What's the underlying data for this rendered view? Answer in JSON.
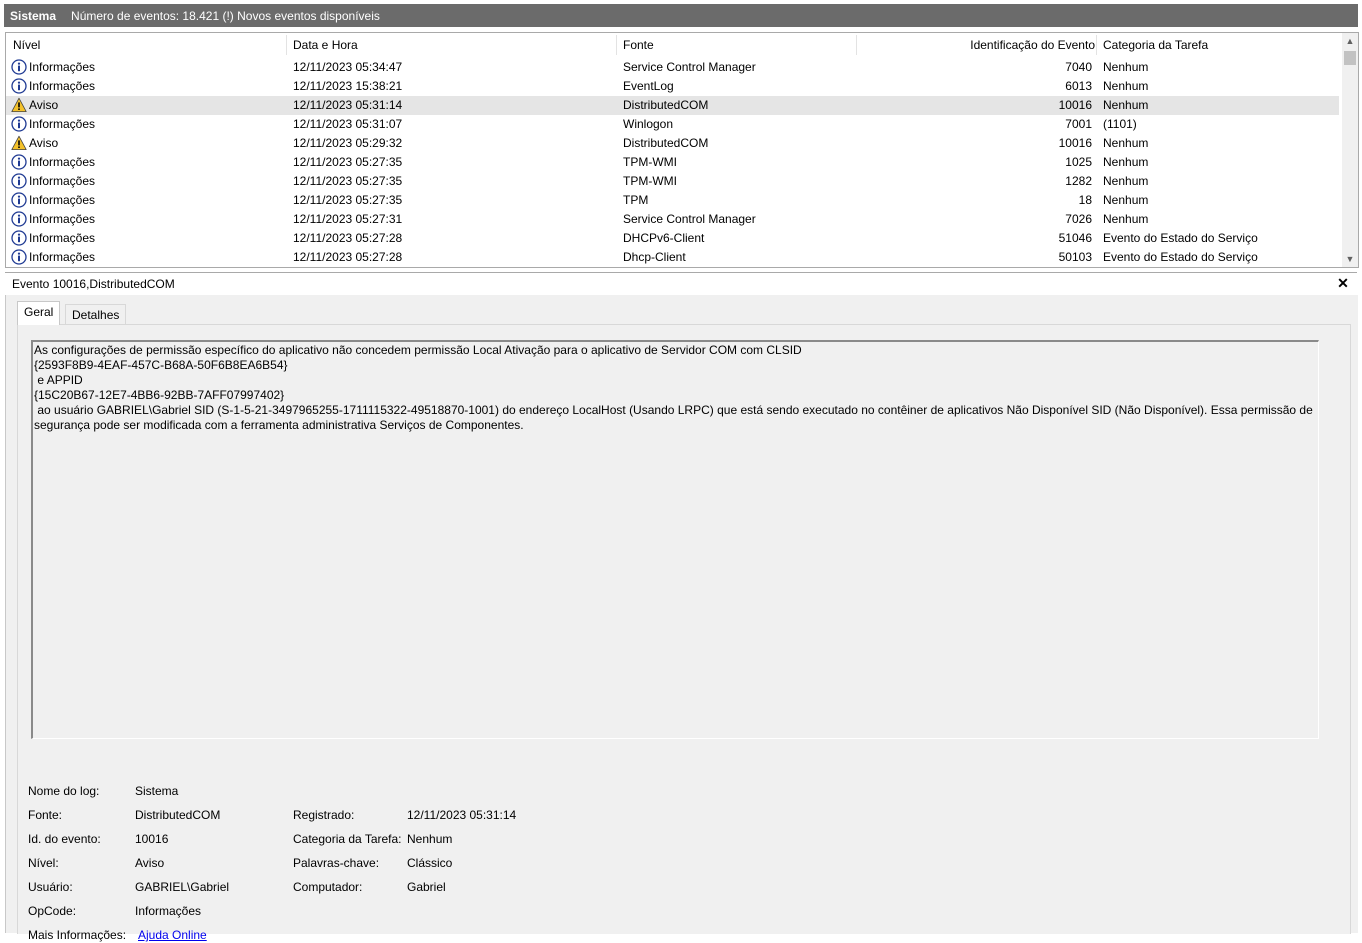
{
  "header": {
    "log_name": "Sistema",
    "info": "Número de eventos: 18.421 (!) Novos eventos disponíveis"
  },
  "columns": {
    "level": "Nível",
    "date": "Data e Hora",
    "source": "Fonte",
    "id": "Identificação do Evento",
    "category": "Categoria da Tarefa"
  },
  "events": [
    {
      "level": "Informações",
      "icon": "info-icon",
      "date": "12/11/2023 05:34:47",
      "source": "Service Control Manager",
      "id": "7040",
      "category": "Nenhum"
    },
    {
      "level": "Informações",
      "icon": "info-icon",
      "date": "12/11/2023 15:38:21",
      "source": "EventLog",
      "id": "6013",
      "category": "Nenhum"
    },
    {
      "level": "Aviso",
      "icon": "warning-icon",
      "date": "12/11/2023 05:31:14",
      "source": "DistributedCOM",
      "id": "10016",
      "category": "Nenhum",
      "selected": true
    },
    {
      "level": "Informações",
      "icon": "info-icon",
      "date": "12/11/2023 05:31:07",
      "source": "Winlogon",
      "id": "7001",
      "category": "(1101)"
    },
    {
      "level": "Aviso",
      "icon": "warning-icon",
      "date": "12/11/2023 05:29:32",
      "source": "DistributedCOM",
      "id": "10016",
      "category": "Nenhum"
    },
    {
      "level": "Informações",
      "icon": "info-icon",
      "date": "12/11/2023 05:27:35",
      "source": "TPM-WMI",
      "id": "1025",
      "category": "Nenhum"
    },
    {
      "level": "Informações",
      "icon": "info-icon",
      "date": "12/11/2023 05:27:35",
      "source": "TPM-WMI",
      "id": "1282",
      "category": "Nenhum"
    },
    {
      "level": "Informações",
      "icon": "info-icon",
      "date": "12/11/2023 05:27:35",
      "source": "TPM",
      "id": "18",
      "category": "Nenhum"
    },
    {
      "level": "Informações",
      "icon": "info-icon",
      "date": "12/11/2023 05:27:31",
      "source": "Service Control Manager",
      "id": "7026",
      "category": "Nenhum"
    },
    {
      "level": "Informações",
      "icon": "info-icon",
      "date": "12/11/2023 05:27:28",
      "source": "DHCPv6-Client",
      "id": "51046",
      "category": "Evento do Estado do Serviço"
    },
    {
      "level": "Informações",
      "icon": "info-icon",
      "date": "12/11/2023 05:27:28",
      "source": "Dhcp-Client",
      "id": "50103",
      "category": "Evento do Estado do Serviço"
    }
  ],
  "detail": {
    "title": "Evento 10016,DistributedCOM",
    "tabs": [
      "Geral",
      "Detalhes"
    ],
    "message_lines": [
      "As configurações de permissão específico do aplicativo não concedem permissão Local Ativação para o aplicativo de Servidor COM com CLSID",
      "{2593F8B9-4EAF-457C-B68A-50F6B8EA6B54}",
      " e APPID",
      "{15C20B67-12E7-4BB6-92BB-7AFF07997402}",
      " ao usuário GABRIEL\\Gabriel SID (S-1-5-21-3497965255-1711115322-49518870-1001) do endereço LocalHost (Usando LRPC) que está sendo executado no contêiner de aplicativos Não Disponível SID (Não Disponível). Essa permissão de segurança pode ser modificada com a ferramenta administrativa Serviços de Componentes."
    ],
    "props": {
      "log_name_label": "Nome do log:",
      "log_name": "Sistema",
      "source_label": "Fonte:",
      "source": "DistributedCOM",
      "logged_label": "Registrado:",
      "logged": "12/11/2023 05:31:14",
      "event_id_label": "Id. do evento:",
      "event_id": "10016",
      "task_label": "Categoria da Tarefa:",
      "task": "Nenhum",
      "level_label": "Nível:",
      "level": "Aviso",
      "keywords_label": "Palavras-chave:",
      "keywords": "Clássico",
      "user_label": "Usuário:",
      "user": "GABRIEL\\Gabriel",
      "computer_label": "Computador:",
      "computer": "Gabriel",
      "opcode_label": "OpCode:",
      "opcode": "Informações",
      "more_info_label": "Mais Informações:",
      "more_info_link": "Ajuda Online"
    }
  }
}
